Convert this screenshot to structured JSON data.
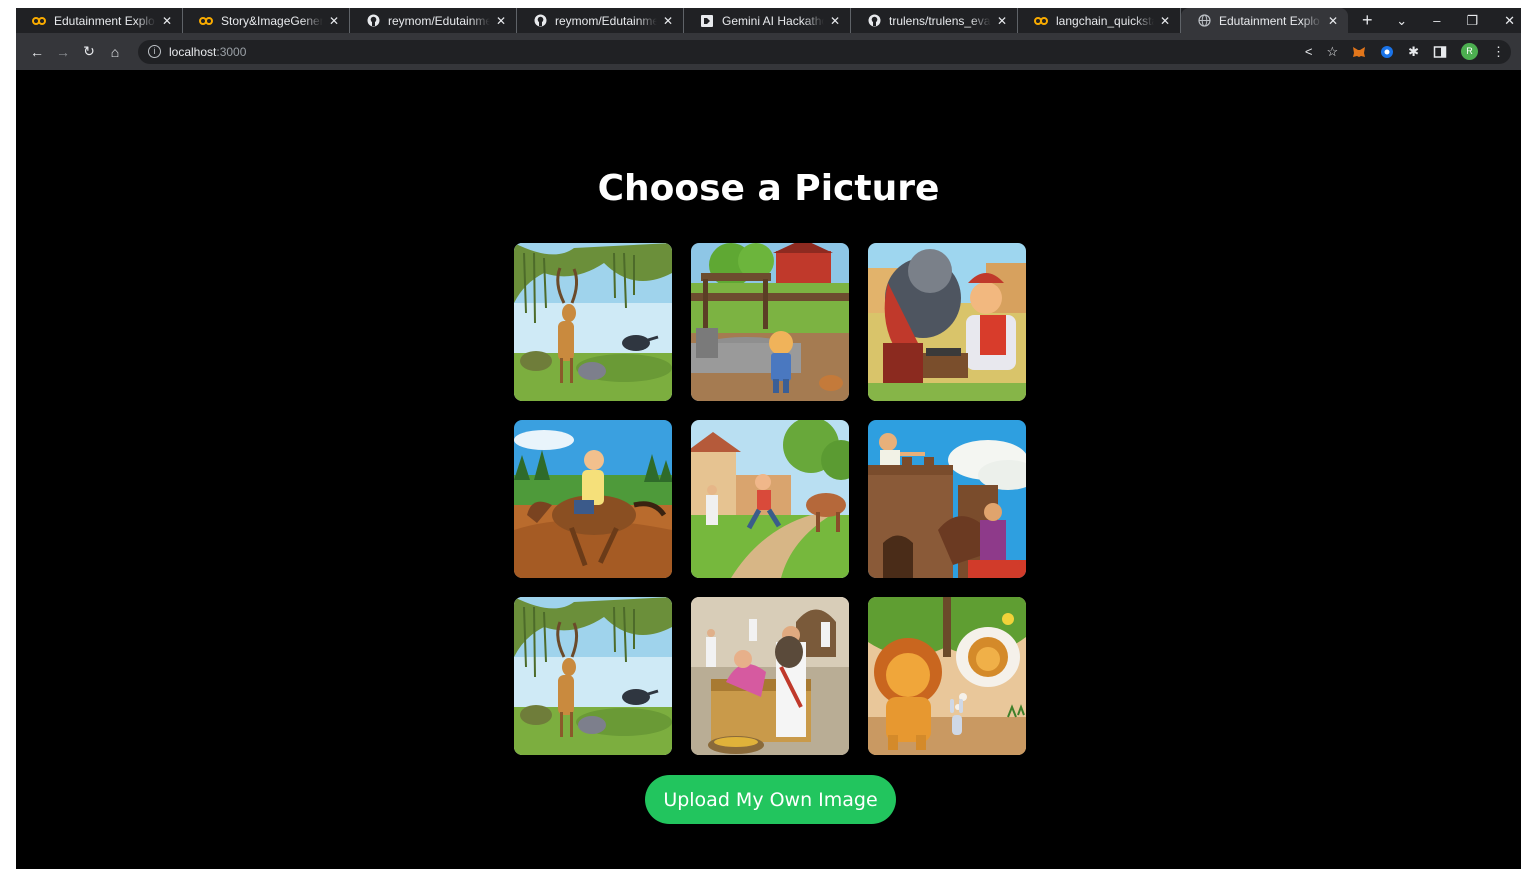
{
  "browser": {
    "tabs": [
      {
        "title": "Edutainment Explo",
        "icon": "colab-icon"
      },
      {
        "title": "Story&ImageGener",
        "icon": "colab-icon"
      },
      {
        "title": "reymom/Edutainme",
        "icon": "github-icon"
      },
      {
        "title": "reymom/Edutainme",
        "icon": "github-icon"
      },
      {
        "title": "Gemini AI Hackatho",
        "icon": "devpost-icon"
      },
      {
        "title": "trulens/trulens_eva",
        "icon": "github-icon"
      },
      {
        "title": "langchain_quicksta",
        "icon": "colab-icon"
      },
      {
        "title": "Edutainment Explo",
        "icon": "globe-icon",
        "active": true
      }
    ],
    "url_host": "localhost",
    "url_port": ":3000",
    "profile_initial": "R"
  },
  "page": {
    "title": "Choose a Picture",
    "pictures": [
      {
        "name": "deer-crow-turtle-mouse"
      },
      {
        "name": "farm-boy-donkey-well"
      },
      {
        "name": "elephant-merchant-market"
      },
      {
        "name": "man-riding-horse"
      },
      {
        "name": "boy-running-cow-village"
      },
      {
        "name": "fort-woman-horse-rider"
      },
      {
        "name": "deer-crow-turtle-mouse"
      },
      {
        "name": "palace-treasure-chest"
      },
      {
        "name": "lion-rabbit-reflection"
      }
    ],
    "upload_label": "Upload My Own Image"
  },
  "colors": {
    "page_bg": "#000000",
    "button_bg": "#22c55e",
    "chrome_dark": "#202124",
    "chrome_toolbar": "#35363a"
  }
}
